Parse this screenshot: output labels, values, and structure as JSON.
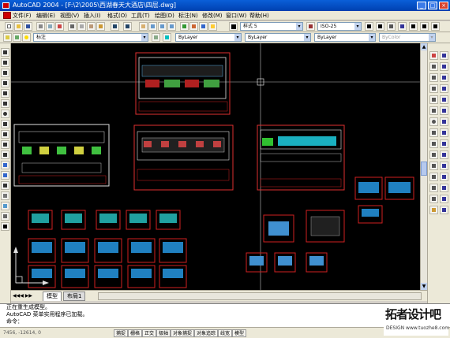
{
  "window": {
    "title": "AutoCAD 2004 - [F:\\2\\2005\\西湖春天大酒店\\四层.dwg]",
    "controls": {
      "minimize": "_",
      "maximize": "□",
      "close": "×"
    }
  },
  "menu": [
    "文件(F)",
    "编辑(E)",
    "视图(V)",
    "插入(I)",
    "格式(O)",
    "工具(T)",
    "绘图(D)",
    "标注(N)",
    "修改(M)",
    "窗口(W)",
    "帮助(H)"
  ],
  "toolbar": {
    "text_style": "样式 5",
    "dim_style": "ISO-25",
    "layer": "标注",
    "color": "ByLayer",
    "linetype": "ByLayer",
    "lineweight": "ByLayer",
    "plotstyle": "ByColor"
  },
  "tabs": {
    "model": "模型",
    "layout": "布局1"
  },
  "command": {
    "line1": "正在重生成模型。",
    "line2": "AutoCAD 菜单实用程序已加载。",
    "prompt": "命令："
  },
  "status": {
    "coords": "7456, -12614, 0",
    "buttons": [
      "捕捉",
      "栅格",
      "正交",
      "极轴",
      "对象捕捉",
      "对象追踪",
      "线宽",
      "模型"
    ]
  },
  "watermark": {
    "main": "拓者设计吧",
    "sub": "DESIGN www.tuozhe8.com"
  },
  "colors": {
    "accent_title": "#0a5fd8",
    "frame": "#e03030",
    "canvas": "#000000"
  }
}
